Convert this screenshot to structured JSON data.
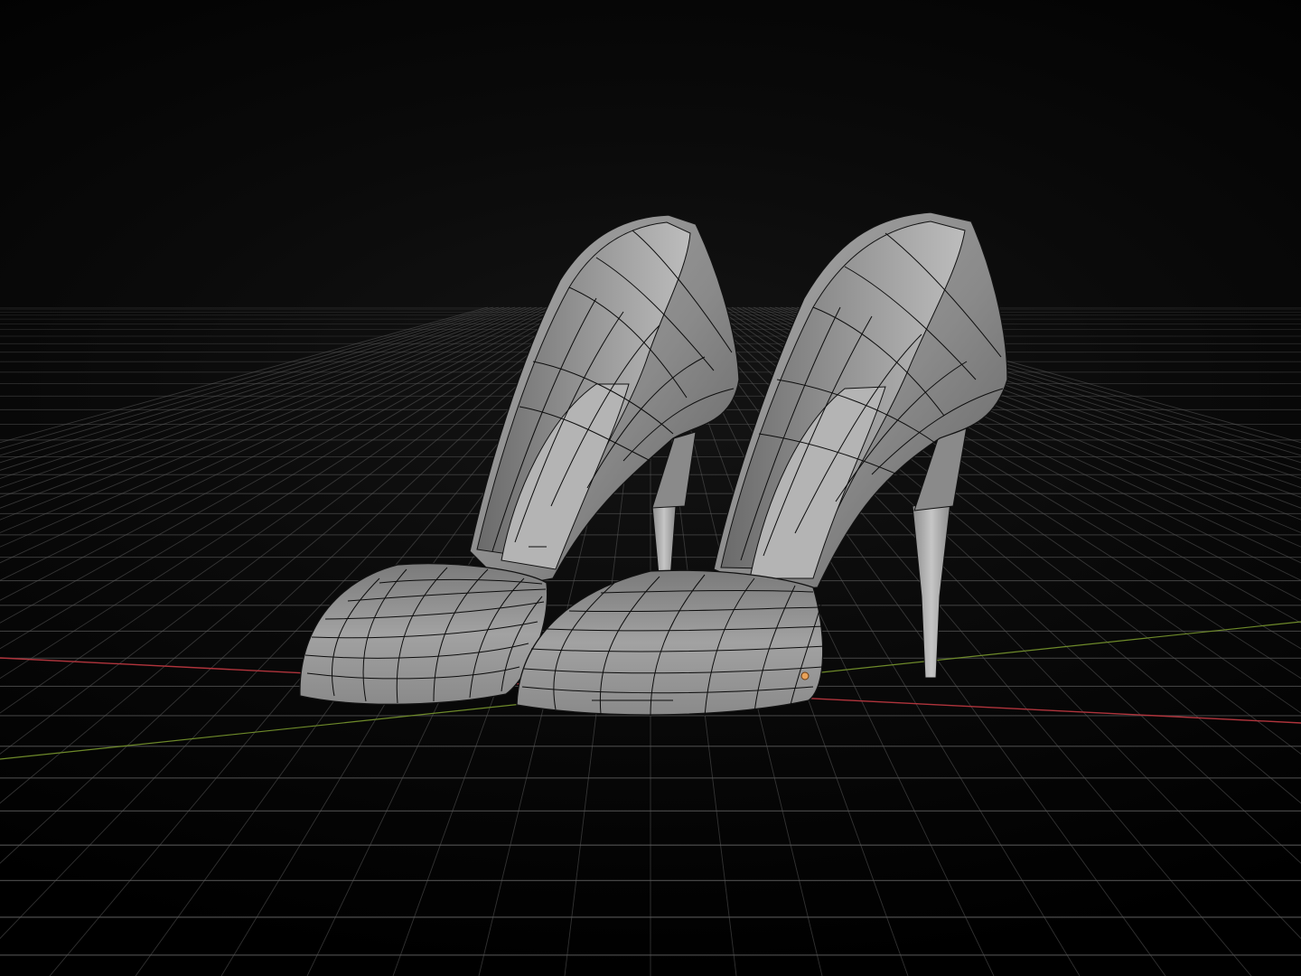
{
  "viewport": {
    "background": "#000000",
    "grid_color": "#5a5a5a",
    "x_axis_color": "#b0343c",
    "y_axis_color": "#6e8a2a",
    "origin_color": "#e8a25a"
  },
  "model": {
    "name": "high-heel-pumps",
    "shading": "solid-wireframe",
    "mesh_color": "#8e8e8e",
    "wire_color": "#101010"
  }
}
